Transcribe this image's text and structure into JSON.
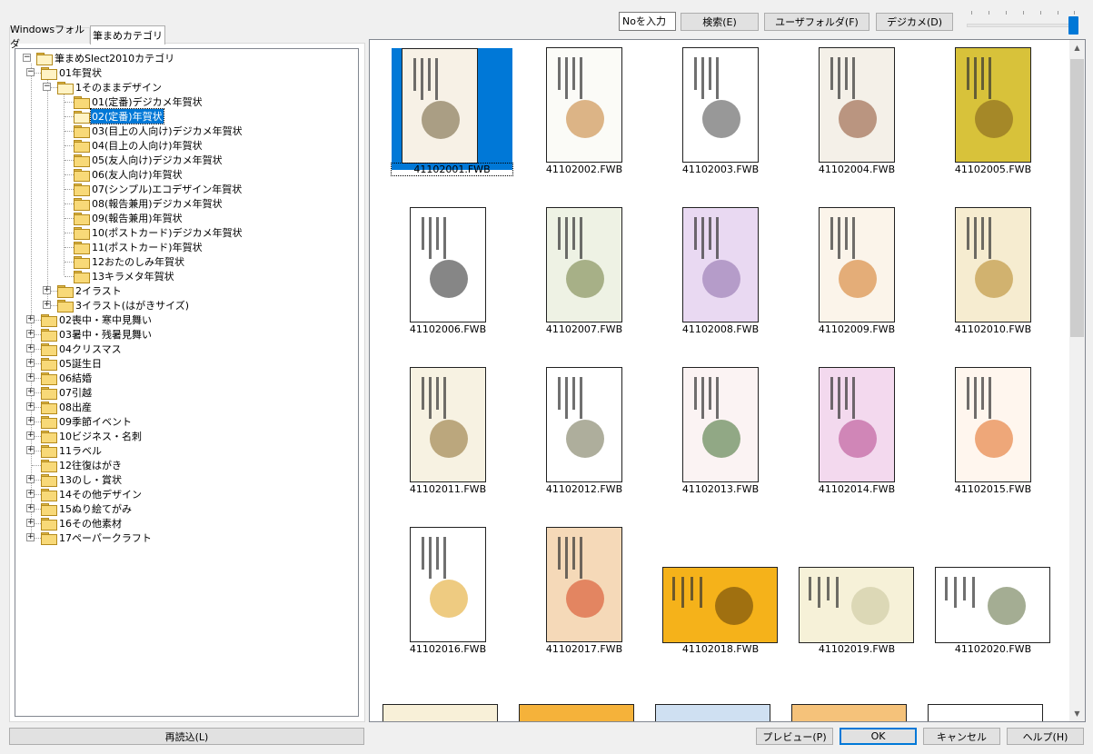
{
  "toolbar": {
    "no_input_value": "Noを入力",
    "search_label": "検索(E)",
    "user_folder_label": "ユーザフォルダ(F)",
    "digicam_label": "デジカメ(D)"
  },
  "tabs": [
    {
      "label": "Windowsフォルダ"
    },
    {
      "label": "筆まめカテゴリ"
    }
  ],
  "tree": {
    "root": "筆まめSlect2010カテゴリ",
    "items": [
      {
        "label": "01年賀状"
      },
      {
        "label": "1そのままデザイン"
      },
      {
        "label": "01(定番)デジカメ年賀状"
      },
      {
        "label": "02(定番)年賀状"
      },
      {
        "label": "03(目上の人向け)デジカメ年賀状"
      },
      {
        "label": "04(目上の人向け)年賀状"
      },
      {
        "label": "05(友人向け)デジカメ年賀状"
      },
      {
        "label": "06(友人向け)年賀状"
      },
      {
        "label": "07(シンプル)エコデザイン年賀状"
      },
      {
        "label": "08(報告兼用)デジカメ年賀状"
      },
      {
        "label": "09(報告兼用)年賀状"
      },
      {
        "label": "10(ポストカード)デジカメ年賀状"
      },
      {
        "label": "11(ポストカード)年賀状"
      },
      {
        "label": "12おたのしみ年賀状"
      },
      {
        "label": "13キラメタ年賀状"
      },
      {
        "label": "2イラスト"
      },
      {
        "label": "3イラスト(はがきサイズ)"
      },
      {
        "label": "02喪中・寒中見舞い"
      },
      {
        "label": "03暑中・残暑見舞い"
      },
      {
        "label": "04クリスマス"
      },
      {
        "label": "05誕生日"
      },
      {
        "label": "06結婚"
      },
      {
        "label": "07引越"
      },
      {
        "label": "08出産"
      },
      {
        "label": "09季節イベント"
      },
      {
        "label": "10ビジネス・名刺"
      },
      {
        "label": "11ラベル"
      },
      {
        "label": "12往復はがき"
      },
      {
        "label": "13のし・賞状"
      },
      {
        "label": "14その他デザイン"
      },
      {
        "label": "15ぬり絵てがみ"
      },
      {
        "label": "16その他素材"
      },
      {
        "label": "17ペーパークラフト"
      }
    ]
  },
  "thumbnails": [
    {
      "file": "41102001.FWB"
    },
    {
      "file": "41102002.FWB"
    },
    {
      "file": "41102003.FWB"
    },
    {
      "file": "41102004.FWB"
    },
    {
      "file": "41102005.FWB"
    },
    {
      "file": "41102006.FWB"
    },
    {
      "file": "41102007.FWB"
    },
    {
      "file": "41102008.FWB"
    },
    {
      "file": "41102009.FWB"
    },
    {
      "file": "41102010.FWB"
    },
    {
      "file": "41102011.FWB"
    },
    {
      "file": "41102012.FWB"
    },
    {
      "file": "41102013.FWB"
    },
    {
      "file": "41102014.FWB"
    },
    {
      "file": "41102015.FWB"
    },
    {
      "file": "41102016.FWB"
    },
    {
      "file": "41102017.FWB"
    },
    {
      "file": "41102018.FWB"
    },
    {
      "file": "41102019.FWB"
    },
    {
      "file": "41102020.FWB"
    }
  ],
  "footer": {
    "reload_label": "再読込(L)",
    "preview_label": "プレビュー(P)",
    "ok_label": "OK",
    "cancel_label": "キャンセル",
    "help_label": "ヘルプ(H)"
  },
  "colors": {
    "accent": "#0078d7",
    "folder": "#f8d978"
  }
}
